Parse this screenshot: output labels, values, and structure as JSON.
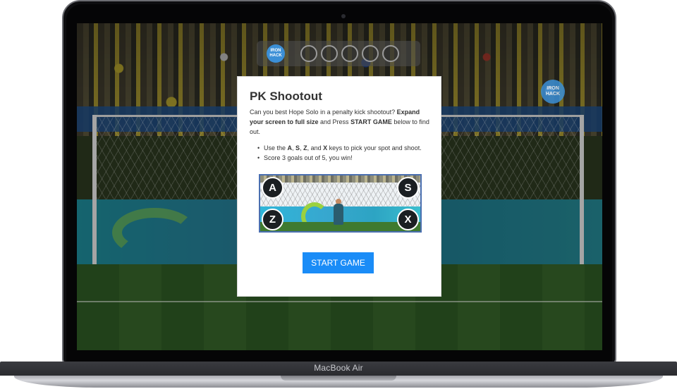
{
  "device": {
    "label": "MacBook Air"
  },
  "hud": {
    "logo_text": "IRON HACK",
    "shot_indicators": [
      "",
      "",
      "",
      "",
      ""
    ]
  },
  "corner_logo": {
    "text": "IRON HACK"
  },
  "modal": {
    "title": "PK Shootout",
    "intro": {
      "part1": "Can you best Hope Solo in a penalty kick shootout? ",
      "part2_bold": "Expand your screen to full size",
      "part3": " and Press ",
      "part4_bold": "START GAME",
      "part5": " below to find out."
    },
    "rules": {
      "rule1": {
        "pre": "Use the ",
        "k1": "A",
        "sep1": ", ",
        "k2": "S",
        "sep2": ", ",
        "k3": "Z",
        "sep3": ", and ",
        "k4": "X",
        "post": " keys to pick your spot and shoot."
      },
      "rule2": "Score 3 goals out of 5, you win!"
    },
    "preview_keys": {
      "top_left": "A",
      "top_right": "S",
      "bottom_left": "Z",
      "bottom_right": "X"
    },
    "start_label": "START GAME"
  },
  "colors": {
    "accent": "#1a8cf7",
    "hud_logo": "#3b8fd6"
  }
}
